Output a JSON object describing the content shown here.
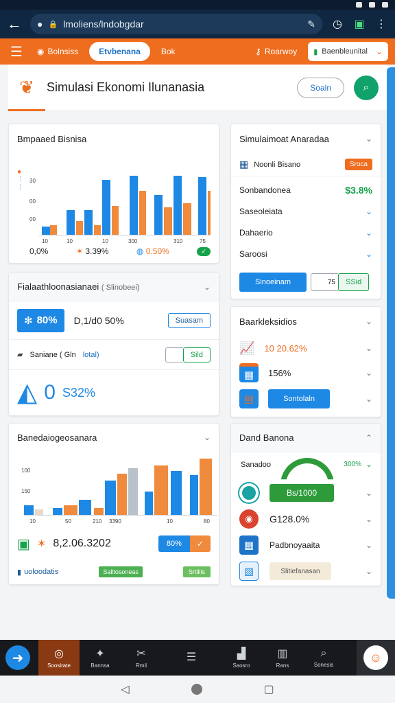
{
  "browser": {
    "url": "lmoliens/lndobgdar",
    "back_icon": "arrow-left-icon"
  },
  "appnav": {
    "items": [
      {
        "label": "Bolnsiss",
        "icon": "dashboard-icon"
      },
      {
        "label": "Etvbenana",
        "icon": ""
      },
      {
        "label": "Bok",
        "icon": ""
      }
    ],
    "right_item": "Roarwoy",
    "select_label": "Baenbleunital"
  },
  "header": {
    "title": "Simulasi Ekonomi Ilunanasia",
    "pill_button": "Soaln"
  },
  "card1": {
    "title": "Bmpaaed Bisnisa",
    "y_ticks": [
      "30",
      "00",
      "00"
    ],
    "x_ticks": [
      "10",
      "10",
      "10",
      "300",
      "310",
      "75"
    ],
    "legend": [
      {
        "label": "0,0%",
        "color": "#1e88e5"
      },
      {
        "label": "3.39%",
        "color": "#ee6d1f"
      },
      {
        "label": "0.50%",
        "color": "#ee6d1f"
      }
    ]
  },
  "card2": {
    "title": "Simulaimoat Anaradaa",
    "sub_label": "Noonli Bisano",
    "sub_badge": "Sroca",
    "items": [
      {
        "label": "Sonbandonea",
        "value": "$3.8%"
      },
      {
        "label": "Saseoleiata",
        "value": ""
      },
      {
        "label": "Dahaerio",
        "value": ""
      },
      {
        "label": "Saroosi",
        "value": ""
      }
    ],
    "primary_button": "Sinoeinam",
    "input_prefix": "75",
    "green_button": "SSid"
  },
  "card3": {
    "title": "Fialaathloonasianaei",
    "title_suffix": "( Slinobeei)",
    "big_badge": "80%",
    "big_value": "D,1/d0 50%",
    "outline_button_1": "Suasam",
    "row2_label": "Saniane ( Gln",
    "row2_suffix": "lotal)",
    "outline_button_2": "Sild",
    "big_number": "0",
    "big_number_suffix": "S32%"
  },
  "card4": {
    "title": "Baarkleksidios",
    "rows": [
      {
        "value": "10 20.62%",
        "color": "#ee6d1f"
      },
      {
        "value": "156%",
        "color": "#222"
      }
    ],
    "button": "Sontolaln"
  },
  "card5": {
    "title": "Banedaiogeosanara",
    "y_ticks": [
      "100",
      "150"
    ],
    "x_ticks": [
      "10",
      "50",
      "210",
      "3390",
      "10",
      "80"
    ],
    "value": "8,2.06.3202",
    "pct": "80%",
    "footer_label": "uoloodatis",
    "footer_chip1": "Salltosoneas",
    "footer_chip2": "Srtlilis"
  },
  "card6": {
    "title": "Dand Banona",
    "gauge_label": "Sanadoo",
    "gauge_value": "300%",
    "rows": [
      {
        "label": "Bs/1000",
        "kind": "green-bar"
      },
      {
        "label": "G128.0%",
        "kind": "text"
      },
      {
        "label": "Padbnoyaaita",
        "kind": "text"
      },
      {
        "label": "Slitiefanasan",
        "kind": "beige-chip"
      }
    ]
  },
  "bottomnav": {
    "items": [
      {
        "label": "Soosirate",
        "icon": "compass-icon"
      },
      {
        "label": "Bannsa",
        "icon": "people-icon"
      },
      {
        "label": "Rmil",
        "icon": "scissors-icon"
      },
      {
        "label": "",
        "icon": "layers-icon"
      },
      {
        "label": "Saosro",
        "icon": "chart-icon"
      },
      {
        "label": "Rans",
        "icon": "building-icon"
      },
      {
        "label": "Sonesis",
        "icon": "search-icon"
      }
    ]
  }
}
